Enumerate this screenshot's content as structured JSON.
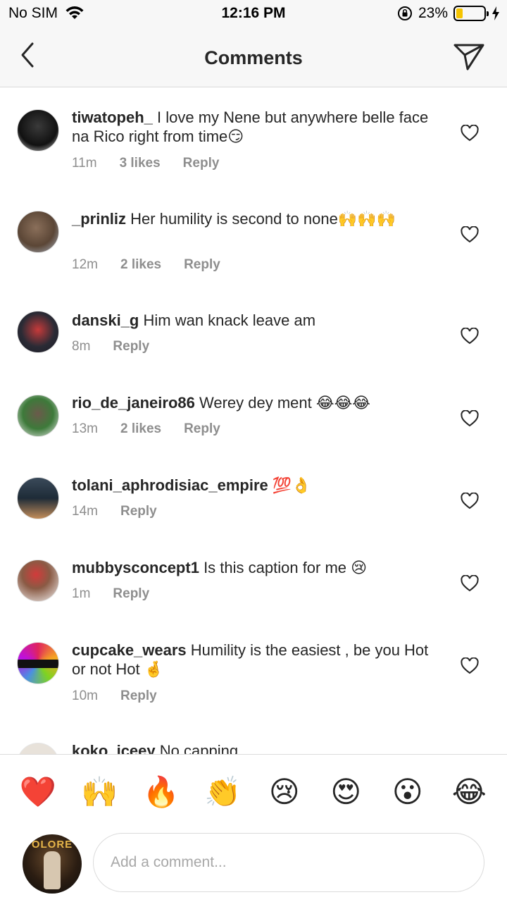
{
  "status_bar": {
    "carrier": "No SIM",
    "time": "12:16 PM",
    "battery_percent": "23%",
    "battery_level": 0.23
  },
  "header": {
    "title": "Comments"
  },
  "comments": [
    {
      "user": "tiwatopeh_",
      "text": "I love my Nene but anywhere belle face na Rico right from time😏",
      "time": "11m",
      "likes": "3 likes",
      "reply": "Reply"
    },
    {
      "user": "_prinliz",
      "text": "Her humility is second to none🙌🙌🙌",
      "time": "12m",
      "likes": "2 likes",
      "reply": "Reply"
    },
    {
      "user": "danski_g",
      "text": "Him wan knack leave am",
      "time": "8m",
      "likes": "",
      "reply": "Reply"
    },
    {
      "user": "rio_de_janeiro86",
      "text": "Werey dey ment 😂😂😂",
      "time": "13m",
      "likes": "2 likes",
      "reply": "Reply"
    },
    {
      "user": "tolani_aphrodisiac_empire",
      "text": "💯👌",
      "time": "14m",
      "likes": "",
      "reply": "Reply"
    },
    {
      "user": "mubbysconcept1",
      "text": "Is this caption for me 😢",
      "time": "1m",
      "likes": "",
      "reply": "Reply"
    },
    {
      "user": "cupcake_wears",
      "text": "Humility is the easiest , be you Hot or not Hot 🤞",
      "time": "10m",
      "likes": "",
      "reply": "Reply"
    },
    {
      "user": "koko_iceey",
      "text": "No capping",
      "time": "",
      "likes": "",
      "reply": ""
    }
  ],
  "reactions": [
    "❤️",
    "🙌",
    "🔥",
    "👏",
    "😢",
    "😍",
    "😮",
    "😂"
  ],
  "input": {
    "placeholder": "Add a comment...",
    "avatar_text": "OLORE"
  },
  "colors": {
    "accent_text": "#262626",
    "meta_text": "#8e8e8e",
    "battery": "#f5c400"
  }
}
